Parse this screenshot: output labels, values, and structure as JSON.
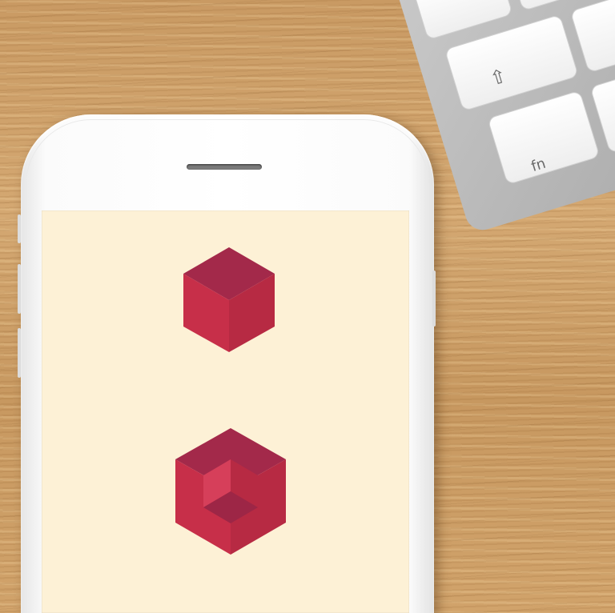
{
  "scene": {
    "description_free": true,
    "colors": {
      "desk": "#cfa16a",
      "screen": "#fdf1d6",
      "cube_top": "#a3294a",
      "cube_left": "#c72f49",
      "cube_right": "#b72a43",
      "cube_inner_light": "#d63f5a"
    },
    "keyboard": {
      "shift_key_glyph": "⇧",
      "fn_key_label": "fn"
    },
    "icons": [
      "cube-icon",
      "cube-cutout-icon"
    ]
  }
}
